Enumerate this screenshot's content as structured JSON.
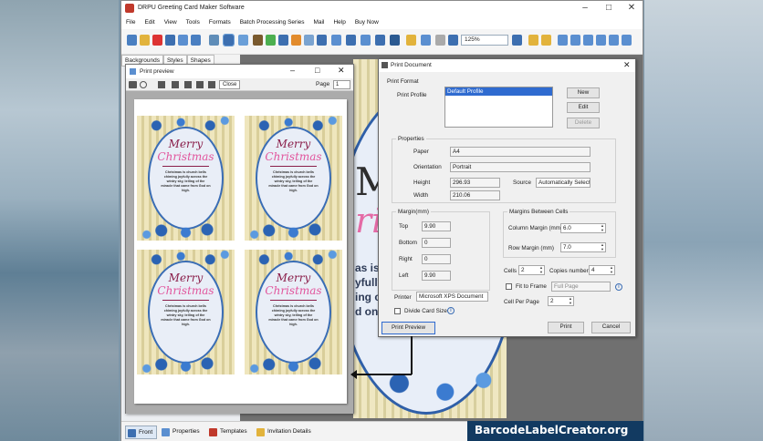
{
  "app": {
    "title": "DRPU Greeting Card Maker Software"
  },
  "menu": [
    "File",
    "Edit",
    "View",
    "Tools",
    "Formats",
    "Batch Processing Series",
    "Mail",
    "Help",
    "Buy Now"
  ],
  "toolbar": {
    "zoom": "125%"
  },
  "left_panel": {
    "tabs": [
      "Backgrounds",
      "Styles",
      "Shapes"
    ]
  },
  "canvas": {
    "big_text_1": "Me",
    "big_text_2": "ri",
    "body_fragments": [
      "as is",
      "yfully",
      "ing c",
      "d on"
    ]
  },
  "print_preview": {
    "title": "Print preview",
    "close_label": "Close",
    "page_label": "Page",
    "page_value": "1",
    "card": {
      "line1": "Merry",
      "line2": "Christmas",
      "message": "Christmas is church bells chiming joyfully across the wintry sky, telling of the miracle that came from God on high."
    }
  },
  "print_document": {
    "title": "Print Document",
    "print_format_label": "Print Format",
    "print_profile_label": "Print Profile",
    "profiles": [
      "Default Profile"
    ],
    "new_label": "New",
    "edit_label": "Edit",
    "delete_label": "Delete",
    "properties_label": "Properties",
    "paper_label": "Paper",
    "paper_value": "A4",
    "orientation_label": "Orientation",
    "orientation_value": "Portrait",
    "height_label": "Height",
    "height_value": "296.93",
    "width_label": "Width",
    "width_value": "210.06",
    "source_label": "Source",
    "source_value": "Automatically Select",
    "margin_label": "Margin(mm)",
    "top_label": "Top",
    "top_value": "9.90",
    "bottom_label": "Bottom",
    "bottom_value": "0",
    "right_label": "Right",
    "right_value": "0",
    "left_label": "Left",
    "left_value": "9.90",
    "between_label": "Margins Between Cells",
    "col_margin_label": "Column Margin (mm)",
    "col_margin_value": "6.0",
    "row_margin_label": "Row Margin (mm)",
    "row_margin_value": "7.0",
    "cells_label": "Cells",
    "cells_value": "2",
    "copies_label": "Copies number",
    "copies_value": "4",
    "fit_label": "Fit to Frame",
    "fit_value": "Full Page",
    "cell_per_page_label": "Cell Per Page",
    "cell_per_page_value": "2",
    "printer_label": "Printer",
    "printer_value": "Microsoft XPS Document",
    "divide_label": "Divide Card Size",
    "print_preview_button": "Print Preview",
    "print_button": "Print",
    "cancel_button": "Cancel"
  },
  "bottom_tabs": [
    "Front",
    "Properties",
    "Templates",
    "Invitation Details"
  ],
  "watermark": "BarcodeLabelCreator.org"
}
